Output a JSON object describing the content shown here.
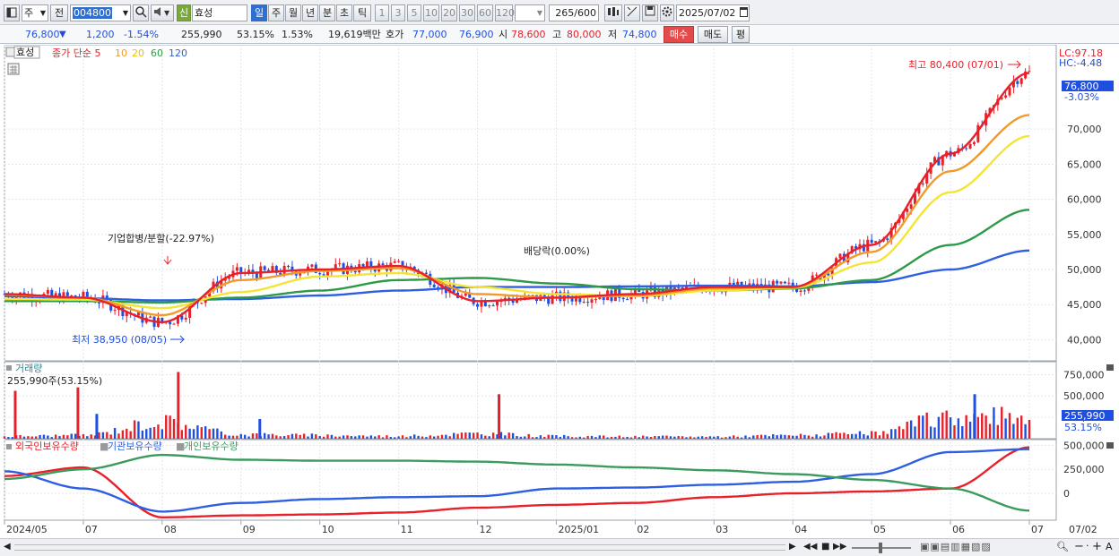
{
  "toolbar": {
    "market": "주",
    "prev": "전",
    "code": "004800",
    "credit_badge": "신",
    "name": "효성",
    "periods": [
      "일",
      "주",
      "월",
      "년",
      "분",
      "초",
      "틱"
    ],
    "numbers": [
      "1",
      "3",
      "5",
      "10",
      "20",
      "30",
      "60",
      "120"
    ],
    "count": "265",
    "count_total": "/600",
    "date": "2025/07/02"
  },
  "quote": {
    "price": "76,800",
    "change_arrow": "▼",
    "change": "1,200",
    "change_pct": "-1.54%",
    "volume": "255,990",
    "volume_pct": "53.15%",
    "turnover_pct": "1.53%",
    "amount": "19,619백만",
    "ask_label": "호가",
    "ask": "77,000",
    "bid": "76,900",
    "open_label": "시",
    "open": "78,600",
    "high_label": "고",
    "high": "80,000",
    "low_label": "저",
    "low": "74,800",
    "buy": "매수",
    "sell": "매도",
    "eval": "평"
  },
  "price_pane": {
    "stock_tag": "효성",
    "legend": {
      "main": "종가 단순 5",
      "ma10": "10",
      "ma20": "20",
      "ma60": "60",
      "ma120": "120"
    },
    "lc": "LC:97.18",
    "hc": "HC:-4.48",
    "last_price": "76,800",
    "last_pct": "-3.03%",
    "y_ticks": [
      "70,000",
      "65,000",
      "60,000",
      "55,000",
      "50,000",
      "45,000",
      "40,000"
    ],
    "high_annot": "최고 80,400 (07/01)",
    "low_annot": "최저 38,950 (08/05)",
    "event_merge": "기업합병/분할(-22.97%)",
    "event_dividend": "배당락(0.00%)"
  },
  "volume_pane": {
    "title": "거래량",
    "readout": "255,990주(53.15%)",
    "y_ticks": [
      "750,000",
      "500,000",
      "250,000"
    ],
    "last_value": "255,990",
    "last_pct": "53.15%"
  },
  "holdings_pane": {
    "series_names": [
      "외국인보유수량",
      "기관보유수량",
      "개인보유수량"
    ],
    "y_ticks": [
      "500,000",
      "250,000",
      "0"
    ]
  },
  "x_axis": [
    "2024/05",
    "07",
    "08",
    "09",
    "10",
    "11",
    "12",
    "2025/01",
    "02",
    "03",
    "04",
    "05",
    "06",
    "07",
    "07/02"
  ],
  "colors": {
    "up": "#e8202a",
    "down": "#1f4fe0",
    "ma5": "#e8202a",
    "ma10": "#f19a2a",
    "ma20": "#f4e434",
    "ma60": "#2d9a47",
    "ma120": "#2e5fe0",
    "foreign": "#e8202a",
    "inst": "#2e5fe0",
    "indiv": "#3c9a5f"
  },
  "chart_data": [
    {
      "type": "line",
      "title": "효성 종가 단순 5 10 20 60 120",
      "x": [
        "2024/05",
        "07",
        "08",
        "09",
        "10",
        "11",
        "12",
        "2025/01",
        "02",
        "03",
        "04",
        "05",
        "06",
        "07"
      ],
      "series": [
        {
          "name": "5",
          "values": [
            46500,
            46000,
            42500,
            49500,
            50000,
            50500,
            45500,
            46000,
            46500,
            47500,
            47500,
            53500,
            66500,
            78000
          ]
        },
        {
          "name": "10",
          "values": [
            46400,
            46000,
            43500,
            48500,
            49800,
            50200,
            46500,
            46000,
            46300,
            47300,
            47500,
            52500,
            64000,
            72000
          ]
        },
        {
          "name": "20",
          "values": [
            45800,
            45700,
            44500,
            46800,
            49000,
            49500,
            47500,
            46500,
            46200,
            47000,
            47400,
            51000,
            61000,
            69000
          ]
        },
        {
          "name": "60",
          "values": [
            45500,
            45500,
            45300,
            46000,
            47000,
            48500,
            48800,
            48000,
            47200,
            47000,
            47300,
            48500,
            53500,
            58500
          ]
        },
        {
          "name": "120",
          "values": [
            46200,
            45900,
            45600,
            45800,
            46300,
            47000,
            47500,
            47500,
            47600,
            47700,
            47600,
            48200,
            50000,
            52700
          ]
        }
      ],
      "ylim": [
        37000,
        82000
      ],
      "annotations": [
        "최고 80,400 (07/01)",
        "최저 38,950 (08/05)",
        "기업합병/분할(-22.97%)",
        "배당락(0.00%)"
      ]
    },
    {
      "type": "bar",
      "title": "거래량",
      "categories": [
        "2024/05",
        "07",
        "08",
        "09",
        "10",
        "11",
        "12",
        "2025/01",
        "02",
        "03",
        "04",
        "05",
        "06",
        "07"
      ],
      "values": [
        30000,
        40000,
        200000,
        50000,
        40000,
        30000,
        60000,
        30000,
        25000,
        25000,
        40000,
        60000,
        250000,
        255990
      ],
      "spikes": [
        {
          "x": "2024/05",
          "value": 560000
        },
        {
          "x": "07",
          "value": 290000
        },
        {
          "x": "08",
          "value": 780000
        },
        {
          "x": "09",
          "value": 230000
        },
        {
          "x": "12",
          "value": 520000
        },
        {
          "x": "06",
          "value": 520000
        },
        {
          "x": "07",
          "value": 600000
        }
      ],
      "ylim": [
        0,
        900000
      ]
    },
    {
      "type": "line",
      "title": "외국인보유수량 기관보유수량 개인보유수량",
      "x": [
        "2024/05",
        "07",
        "08",
        "09",
        "10",
        "11",
        "12",
        "2025/01",
        "02",
        "03",
        "04",
        "05",
        "06",
        "07"
      ],
      "series": [
        {
          "name": "외국인보유수량",
          "values": [
            180000,
            270000,
            -250000,
            -230000,
            -220000,
            -200000,
            -150000,
            -120000,
            -100000,
            -40000,
            0,
            20000,
            50000,
            480000
          ]
        },
        {
          "name": "기관보유수량",
          "values": [
            230000,
            50000,
            -190000,
            -100000,
            -60000,
            -40000,
            -30000,
            50000,
            60000,
            90000,
            120000,
            200000,
            430000,
            460000
          ]
        },
        {
          "name": "개인보유수량",
          "values": [
            150000,
            250000,
            400000,
            350000,
            340000,
            340000,
            330000,
            300000,
            270000,
            240000,
            200000,
            140000,
            50000,
            -180000
          ]
        }
      ],
      "ylim": [
        -280000,
        560000
      ]
    }
  ]
}
